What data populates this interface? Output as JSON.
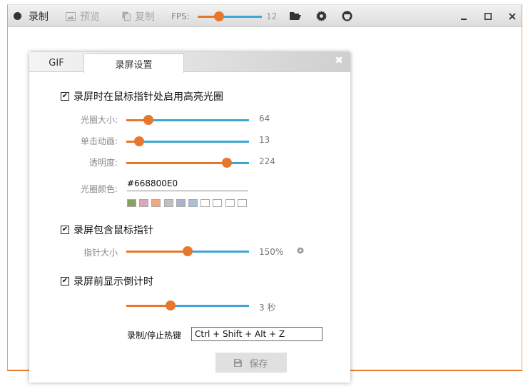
{
  "toolbar": {
    "record_label": "录制",
    "preview_label": "预览",
    "copy_label": "复制",
    "fps_label": "FPS:",
    "fps_value": "12",
    "fps_fraction": 0.3
  },
  "settings_panel": {
    "tabs": [
      {
        "label": "GIF"
      },
      {
        "label": "录屏设置"
      }
    ],
    "close_glyph": "✖",
    "highlight": {
      "checkbox_label": "录屏时在鼠标指针处启用高亮光圈",
      "checked": true,
      "halo_size_label": "光圈大小:",
      "halo_size_value": "64",
      "halo_size_fraction": 0.15,
      "click_anim_label": "单击动画:",
      "click_anim_value": "13",
      "click_anim_fraction": 0.07,
      "opacity_label": "透明度:",
      "opacity_value": "224",
      "opacity_fraction": 0.85,
      "halo_color_label": "光圈颜色:",
      "halo_color_value": "#668800E0",
      "swatches": [
        "#8aa060",
        "#dca8b8",
        "#f0a880",
        "#c0c0c0",
        "#a8b4cc",
        "#a8c0d4",
        "#ffffff",
        "#ffffff",
        "#ffffff",
        "#ffffff"
      ]
    },
    "cursor": {
      "checkbox_label": "录屏包含鼠标指针",
      "checked": true,
      "pointer_size_label": "指针大小",
      "pointer_size_value": "150%",
      "pointer_size_fraction": 0.5
    },
    "countdown": {
      "checkbox_label": "录屏前显示倒计时",
      "checked": true,
      "value": "3 秒",
      "fraction": 0.35
    },
    "hotkey": {
      "label": "录制/停止热键",
      "value": "Ctrl + Shift + Alt + Z"
    },
    "save_label": "保存"
  },
  "colors": {
    "accent_orange": "#e8772e",
    "track_blue": "#3ea6d4"
  }
}
